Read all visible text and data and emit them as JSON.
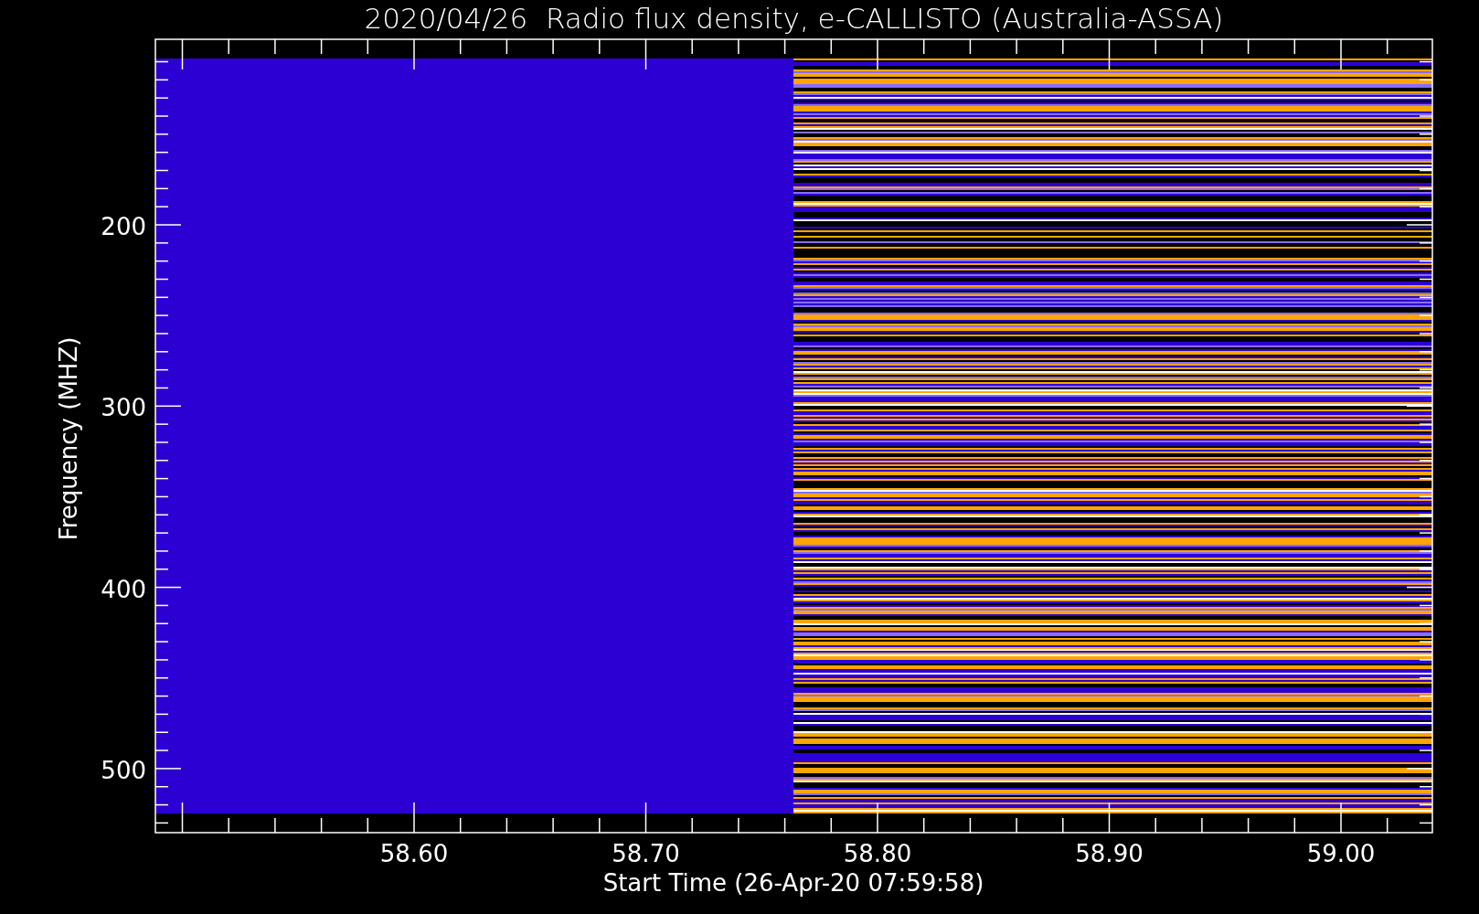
{
  "title": "2020/04/26  Radio flux density, e-CALLISTO (Australia-ASSA)",
  "y_axis": {
    "title": "Frequency (MHZ)",
    "tick_labels": [
      "200",
      "300",
      "400",
      "500"
    ]
  },
  "x_axis": {
    "title": "Start Time (26-Apr-20 07:59:58)",
    "tick_labels": [
      "58.60",
      "58.70",
      "58.80",
      "58.90",
      "59.00"
    ]
  }
}
